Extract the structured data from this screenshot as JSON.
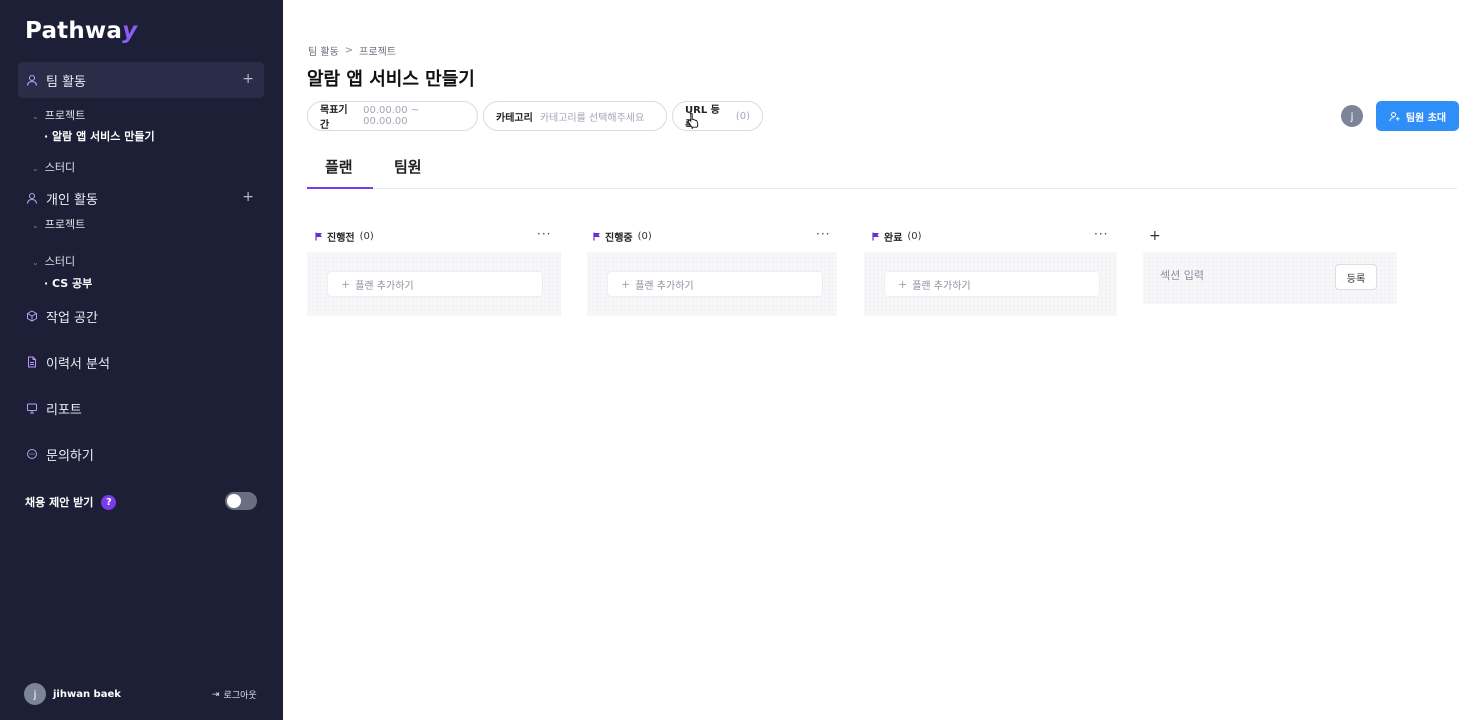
{
  "brand": {
    "name": "Pathwa",
    "accent": "y"
  },
  "sidebar": {
    "team": {
      "label": "팀 활동",
      "project_label": "프로젝트",
      "project_item": "· 알람 앱 서비스 만들기",
      "study_label": "스터디"
    },
    "personal": {
      "label": "개인 활동",
      "project_label": "프로젝트",
      "study_label": "스터디",
      "study_item": "· CS 공부"
    },
    "workspace": "작업 공간",
    "resume": "이력서 분석",
    "report": "리포트",
    "inquiry": "문의하기",
    "recruit_label": "채용 제안 받기",
    "recruit_help": "?",
    "user_initial": "j",
    "user_name": "jihwan baek",
    "logout": "로그아웃"
  },
  "breadcrumb": {
    "root": "팀 활동",
    "sep": ">",
    "current": "프로젝트"
  },
  "page_title": "알람 앱 서비스 만들기",
  "chips": {
    "period_label": "목표기간",
    "period_value": "00.00.00 ~ 00.00.00",
    "category_label": "카테고리",
    "category_value": "카테고리를 선택해주세요",
    "url_label": "URL 등록",
    "url_value": "(0)"
  },
  "header": {
    "avatar_initial": "j",
    "invite_label": "팀원 초대"
  },
  "tabs": {
    "plan": "플랜",
    "members": "팀원"
  },
  "columns": [
    {
      "title": "진행전",
      "count": "(0)",
      "add_label": "플랜 추가하기"
    },
    {
      "title": "진행중",
      "count": "(0)",
      "add_label": "플랜 추가하기"
    },
    {
      "title": "완료",
      "count": "(0)",
      "add_label": "플랜 추가하기"
    }
  ],
  "new_section": {
    "placeholder": "섹션 입력",
    "submit_label": "등록"
  },
  "colors": {
    "sidebar_bg": "#1d1f36",
    "accent_purple": "#7c3aed",
    "primary_blue": "#2f8ef7"
  }
}
